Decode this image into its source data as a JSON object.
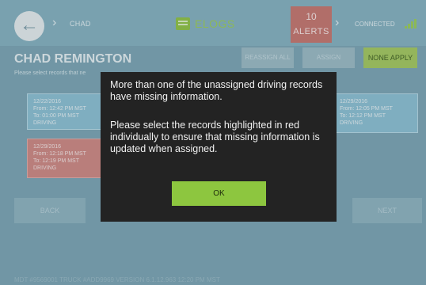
{
  "header": {
    "breadcrumb": "CHAD",
    "logo_text": "ELOGS",
    "alerts_count": "10",
    "alerts_label": "ALERTS",
    "connection_status": "CONNECTED",
    "colors": {
      "bar": "#84b0bf",
      "alerts": "#c9726a",
      "accent": "#9ccc55"
    }
  },
  "page": {
    "title": "CHAD REMINGTON",
    "instruction": "Please select records that ne"
  },
  "actions": {
    "reassign": "REASSIGN ALL",
    "assign": "ASSIGN",
    "none_apply": "NONE APPLY"
  },
  "records": [
    {
      "date": "12/22/2016",
      "from": "From: 12:42 PM MST",
      "to": "To: 01:00 PM MST",
      "status": "DRIVING",
      "highlight": "blue"
    },
    {
      "date": "12/29/2016",
      "from": "From: 12:18 PM MST",
      "to": "To: 12:19 PM MST",
      "status": "DRIVING",
      "highlight": "red"
    },
    {
      "date": "12/29/2016",
      "from": "From: 12:05 PM MST",
      "to": "To: 12:12 PM MST",
      "status": "DRIVING",
      "highlight": "blue"
    }
  ],
  "nav": {
    "back": "BACK",
    "next": "NEXT"
  },
  "footer": {
    "text": "MDT #9569001    TRUCK #ADD9969    VERSION 6.1.12.963    12:20 PM MST"
  },
  "dialog": {
    "line1": "More than one of the unassigned driving records have missing information.",
    "line2": "Please select the records highlighted in red individually to ensure that missing information is updated when assigned.",
    "ok_label": "OK",
    "colors": {
      "bg": "#232323",
      "ok": "#8dc63f"
    }
  }
}
